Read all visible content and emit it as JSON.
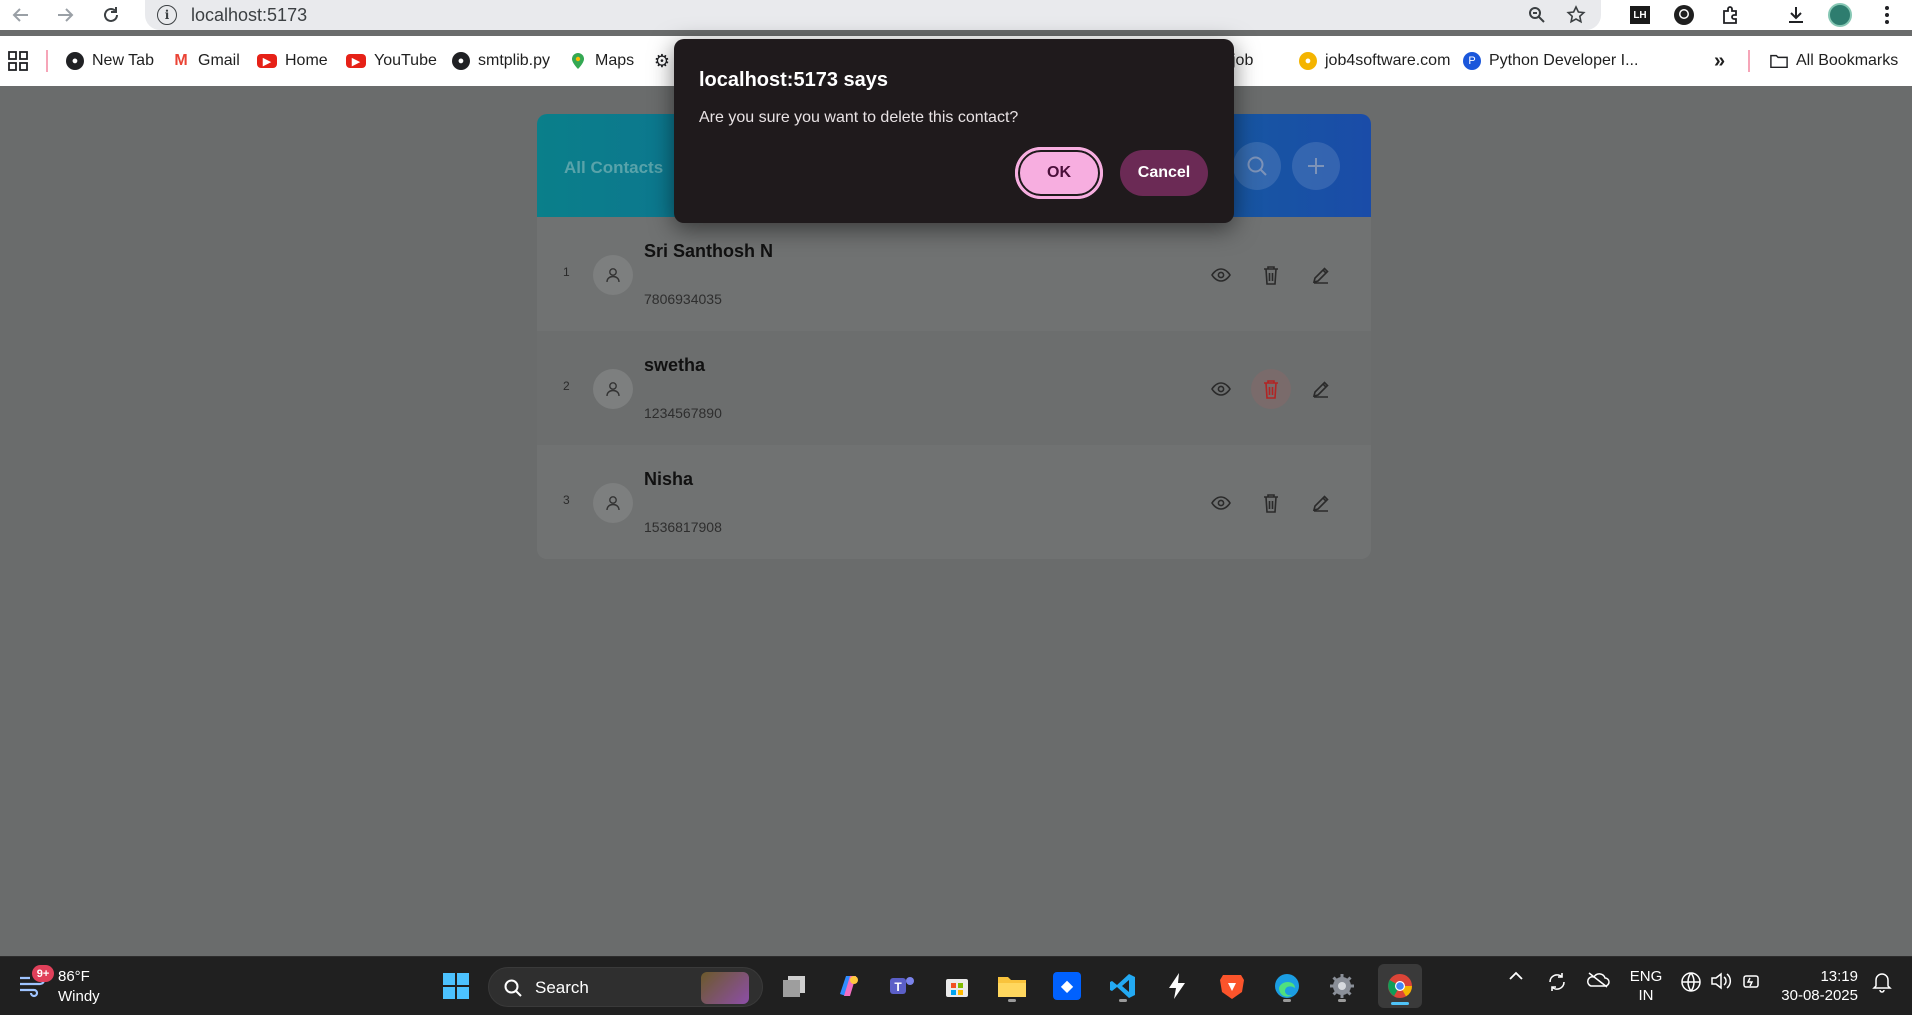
{
  "browser": {
    "url": "localhost:5173",
    "bookmarks": [
      {
        "label": "New Tab"
      },
      {
        "label": "Gmail"
      },
      {
        "label": "Home"
      },
      {
        "label": "YouTube"
      },
      {
        "label": "smtplib.py"
      },
      {
        "label": "Maps"
      },
      {
        "label": "job"
      },
      {
        "label": "job4software.com"
      },
      {
        "label": "Python Developer I..."
      }
    ],
    "overflow_label": "»",
    "all_bookmarks_label": "All Bookmarks"
  },
  "app": {
    "header_title": "All Contacts",
    "contacts": [
      {
        "index": "1",
        "name": "Sri Santhosh N",
        "phone": "7806934035"
      },
      {
        "index": "2",
        "name": "swetha",
        "phone": "1234567890"
      },
      {
        "index": "3",
        "name": "Nisha",
        "phone": "1536817908"
      }
    ]
  },
  "dialog": {
    "title": "localhost:5173 says",
    "message": "Are you sure you want to delete this contact?",
    "ok_label": "OK",
    "cancel_label": "Cancel"
  },
  "taskbar": {
    "weather_temp": "86°F",
    "weather_desc": "Windy",
    "weather_badge": "9+",
    "search_label": "Search",
    "lang_top": "ENG",
    "lang_bottom": "IN",
    "time": "13:19",
    "date": "30-08-2025"
  },
  "colors": {
    "header_gradient_start": "#0a7f8a",
    "header_gradient_end": "#1a4ca8",
    "ok_button": "#f7aee0",
    "cancel_button": "#6b2a55",
    "delete_hover": "#c62828"
  }
}
